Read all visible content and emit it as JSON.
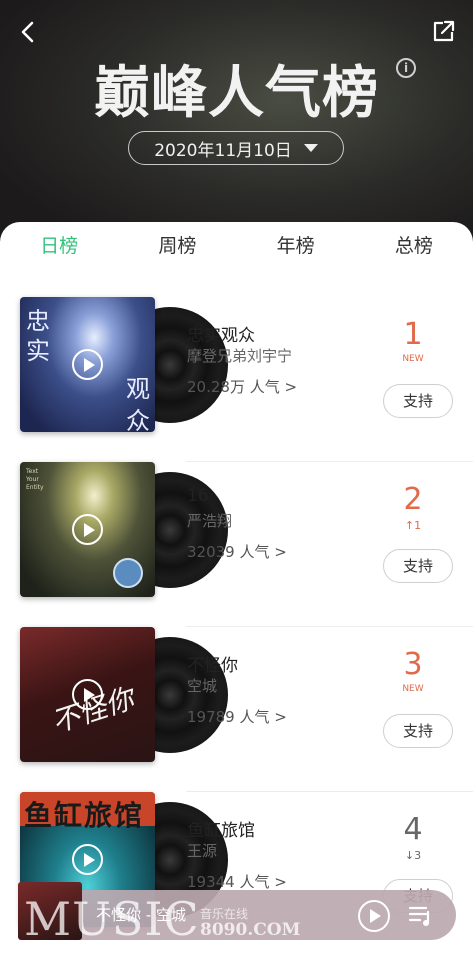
{
  "header": {
    "title": "巅峰人气榜",
    "date": "2020年11月10日"
  },
  "tabs": [
    {
      "label": "日榜",
      "active": true
    },
    {
      "label": "周榜",
      "active": false
    },
    {
      "label": "年榜",
      "active": false
    },
    {
      "label": "总榜",
      "active": false
    }
  ],
  "songs": [
    {
      "rank": "1",
      "trend": "NEW",
      "title": "忠实观众",
      "artist": "摩登兄弟刘宇宁",
      "popularity": "20.28万 人气 >",
      "support_label": "支持",
      "cover_text": [
        "忠",
        "实",
        "观",
        "众"
      ]
    },
    {
      "rank": "2",
      "trend": "↑1",
      "title": "16",
      "artist": "严浩翔",
      "popularity": "32039 人气 >",
      "support_label": "支持",
      "cover_text": [
        "Text",
        "Your",
        "Entity"
      ]
    },
    {
      "rank": "3",
      "trend": "NEW",
      "title": "不怪你",
      "artist": "空城",
      "popularity": "19789 人气 >",
      "support_label": "支持",
      "cover_text": [
        "不怪你"
      ]
    },
    {
      "rank": "4",
      "trend": "↓3",
      "title": "鱼缸旅馆",
      "artist": "王源",
      "popularity": "19344 人气 >",
      "support_label": "支持",
      "cover_text": [
        "鱼缸旅馆"
      ]
    }
  ],
  "player": {
    "now_playing": "不怪你 - 空城"
  },
  "watermark": {
    "music": "MUSIC",
    "small": "音乐在线",
    "url": "8090.COM"
  },
  "colors": {
    "accent": "#31c27c",
    "rank_red": "#e06a4a"
  }
}
